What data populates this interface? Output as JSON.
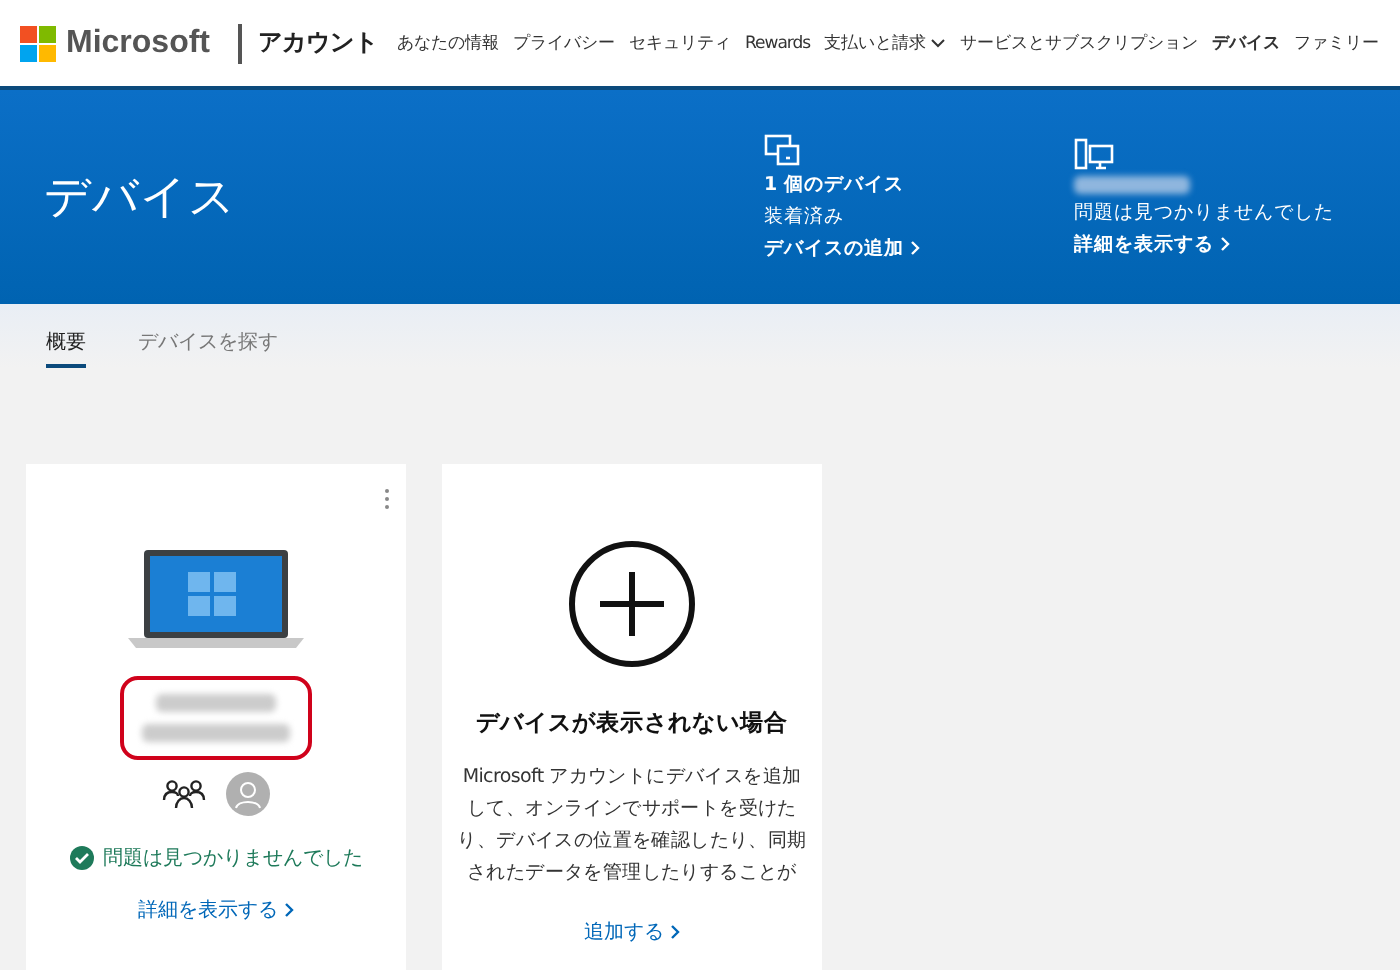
{
  "header": {
    "brand": "Microsoft",
    "section": "アカウント",
    "nav": [
      {
        "label": "あなたの情報",
        "selected": false,
        "dropdown": false
      },
      {
        "label": "プライバシー",
        "selected": false,
        "dropdown": false
      },
      {
        "label": "セキュリティ",
        "selected": false,
        "dropdown": false
      },
      {
        "label": "Rewards",
        "selected": false,
        "dropdown": false
      },
      {
        "label": "支払いと請求",
        "selected": false,
        "dropdown": true
      },
      {
        "label": "サービスとサブスクリプション",
        "selected": false,
        "dropdown": false
      },
      {
        "label": "デバイス",
        "selected": true,
        "dropdown": false
      },
      {
        "label": "ファミリー",
        "selected": false,
        "dropdown": false
      }
    ]
  },
  "banner": {
    "title": "デバイス",
    "summaries": [
      {
        "kind": "count",
        "heading": "1 個のデバイス",
        "subtext": "装着済み",
        "link": "デバイスの追加"
      },
      {
        "kind": "device",
        "heading_hidden": true,
        "subtext": "問題は見つかりませんでした",
        "link": "詳細を表示する"
      }
    ]
  },
  "tabs": [
    {
      "label": "概要",
      "selected": true
    },
    {
      "label": "デバイスを探す",
      "selected": false
    }
  ],
  "device_card": {
    "status": "問題は見つかりませんでした",
    "link": "詳細を表示する",
    "highlighted": true
  },
  "add_card": {
    "title": "デバイスが表示されない場合",
    "body": "Microsoft アカウントにデバイスを追加して、オンラインでサポートを受けたり、デバイスの位置を確認したり、同期されたデータを管理したりすることが",
    "link": "追加する"
  }
}
